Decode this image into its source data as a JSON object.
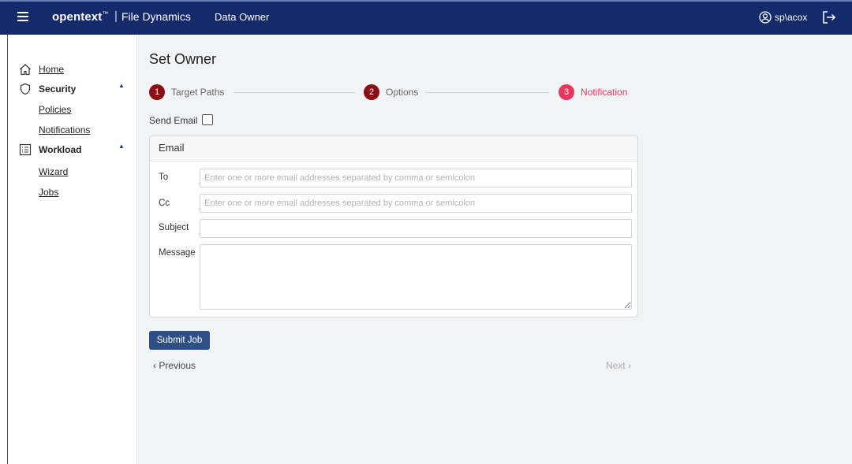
{
  "header": {
    "brand": "opentext",
    "brand_tm": "™",
    "separator": "|",
    "product": "File Dynamics",
    "module": "Data Owner",
    "user": "sp\\acox",
    "icons": [
      "hamburger-icon",
      "user-circle-icon",
      "logout-icon"
    ]
  },
  "sidebar": {
    "home": "Home",
    "security": "Security",
    "policies": "Policies",
    "notifications": "Notifications",
    "workload": "Workload",
    "wizard": "Wizard",
    "jobs": "Jobs",
    "caret": "▲"
  },
  "main": {
    "title": "Set Owner",
    "steps": [
      {
        "number": "1",
        "label": "Target Paths",
        "color": "#8b0e12"
      },
      {
        "number": "2",
        "label": "Options",
        "color": "#8b0e12"
      },
      {
        "number": "3",
        "label": "Notification",
        "color": "#e8365d"
      }
    ],
    "send_email_label": "Send Email",
    "email": {
      "title": "Email",
      "to_label": "To",
      "to_placeholder": "Enter one or more email addresses separated by comma or semicolon",
      "cc_label": "Cc",
      "cc_placeholder": "Enter one or more email addresses separated by comma or semicolon",
      "subject_label": "Subject",
      "message_label": "Message"
    },
    "submit_label": "Submit Job",
    "previous_label": "‹ Previous",
    "next_label": "Next ›"
  },
  "colors": {
    "topbar": "#142a6b",
    "submit": "#2e4f84",
    "step_done": "#8b0e12",
    "step_active": "#e8365d"
  }
}
